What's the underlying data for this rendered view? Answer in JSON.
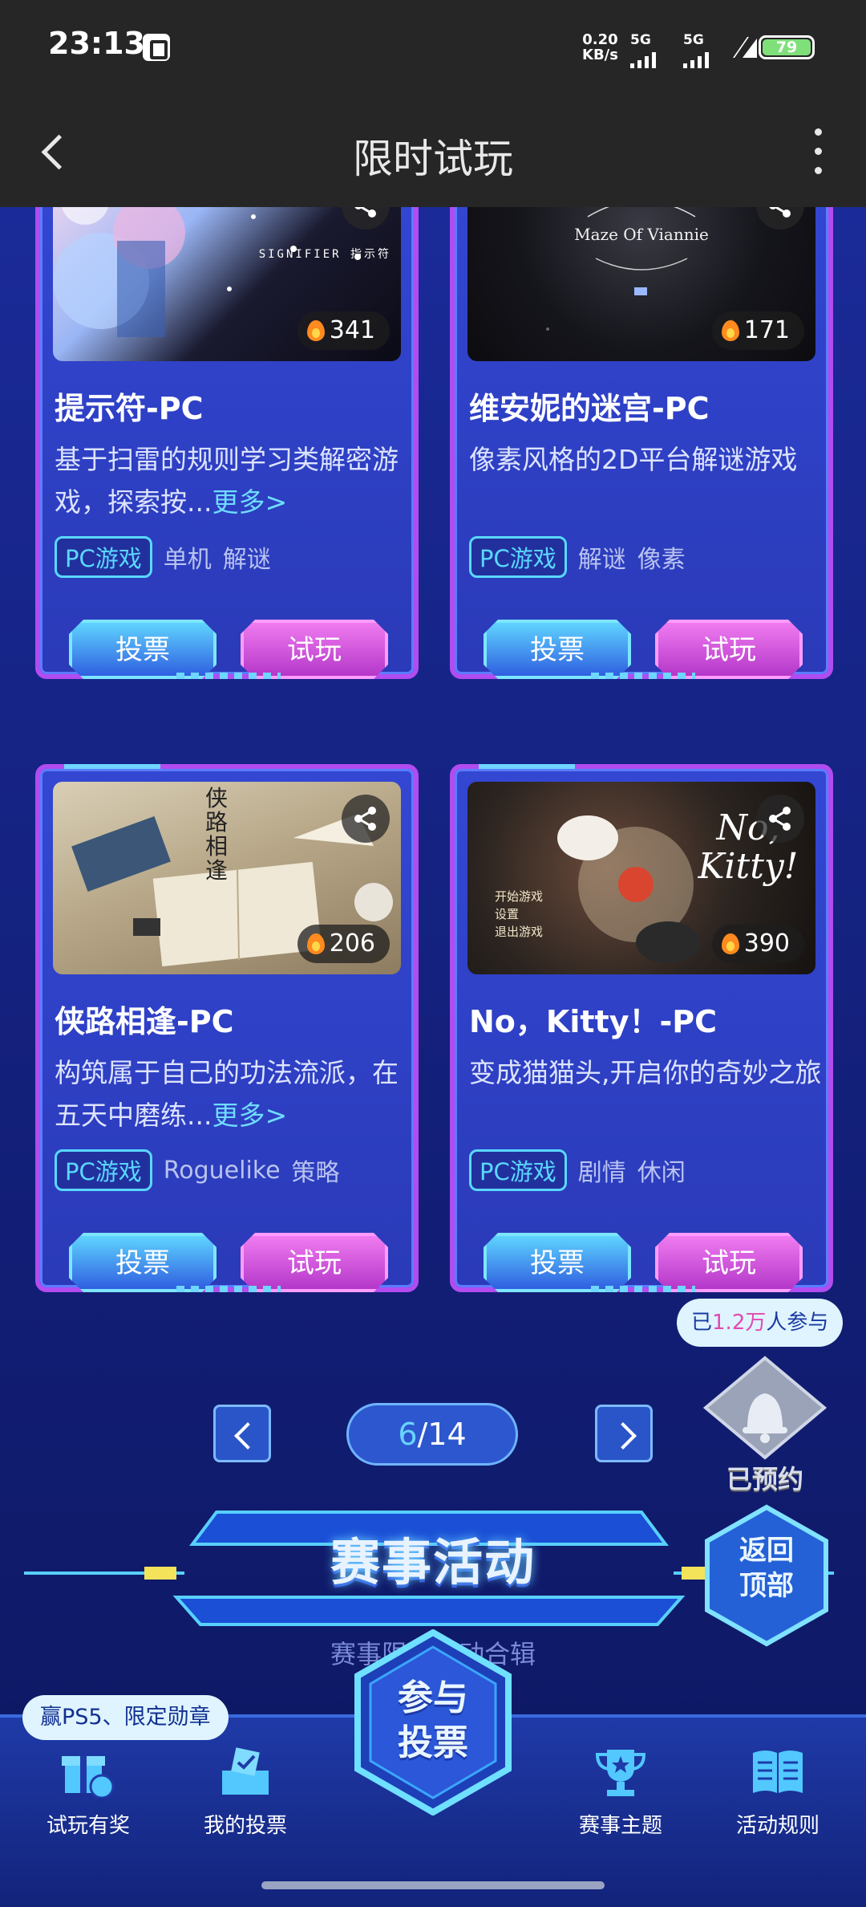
{
  "status_bar": {
    "time": "23:13",
    "net_speed_value": "0.20",
    "net_speed_unit": "KB/s",
    "sim1": "5G",
    "sim2": "5G",
    "battery": "79"
  },
  "nav": {
    "title": "限时试玩"
  },
  "cards": [
    {
      "title": "提示符-PC",
      "desc": "基于扫雷的规则学习类解密游戏，探索按...",
      "more": "更多>",
      "heat": "341",
      "tag_main": "PC游戏",
      "tags": [
        "单机",
        "解谜"
      ],
      "vote": "投票",
      "play": "试玩",
      "cover_art": "SIGNIFIER 指示符"
    },
    {
      "title": "维安妮的迷宫-PC",
      "desc": "像素风格的2D平台解谜游戏",
      "more": "",
      "heat": "171",
      "tag_main": "PC游戏",
      "tags": [
        "解谜",
        "像素"
      ],
      "vote": "投票",
      "play": "试玩",
      "cover_art": "Maze Of Viannie"
    },
    {
      "title": "侠路相逢-PC",
      "desc": "构筑属于自己的功法流派，在五天中磨练...",
      "more": "更多>",
      "heat": "206",
      "tag_main": "PC游戏",
      "tags": [
        "Roguelike",
        "策略"
      ],
      "vote": "投票",
      "play": "试玩",
      "cover_art": "侠路相逢"
    },
    {
      "title": "No，Kitty！-PC",
      "desc": "变成猫猫头,开启你的奇妙之旅",
      "more": "",
      "heat": "390",
      "tag_main": "PC游戏",
      "tags": [
        "剧情",
        "休闲"
      ],
      "vote": "投票",
      "play": "试玩",
      "cover_art": "No, Kitty!",
      "cover_menu": [
        "开始游戏",
        "设置",
        "退出游戏"
      ]
    }
  ],
  "pager": {
    "current": "6",
    "separator": "/",
    "total": "14"
  },
  "reminder": {
    "pre": "已",
    "count": "1.2万",
    "post": "人参与",
    "state": "已预约"
  },
  "back_to_top": {
    "line1": "返回",
    "line2": "顶部"
  },
  "section": {
    "title": "赛事活动",
    "subtitle": "赛事限时活动合辑"
  },
  "bottom_bar": {
    "badge": "赢PS5、限定勋章",
    "join_line1": "参与",
    "join_line2": "投票",
    "items": [
      {
        "label": "试玩有奖",
        "icon": "gift-gamepad-icon"
      },
      {
        "label": "我的投票",
        "icon": "ballot-box-icon"
      },
      {
        "label": "赛事主题",
        "icon": "trophy-icon"
      },
      {
        "label": "活动规则",
        "icon": "book-icon"
      }
    ]
  },
  "colors": {
    "accent_cyan": "#5ad8ff",
    "accent_purple": "#b04cf0",
    "vote_blue": "#2f5fe0",
    "play_pink": "#c84ad8"
  }
}
